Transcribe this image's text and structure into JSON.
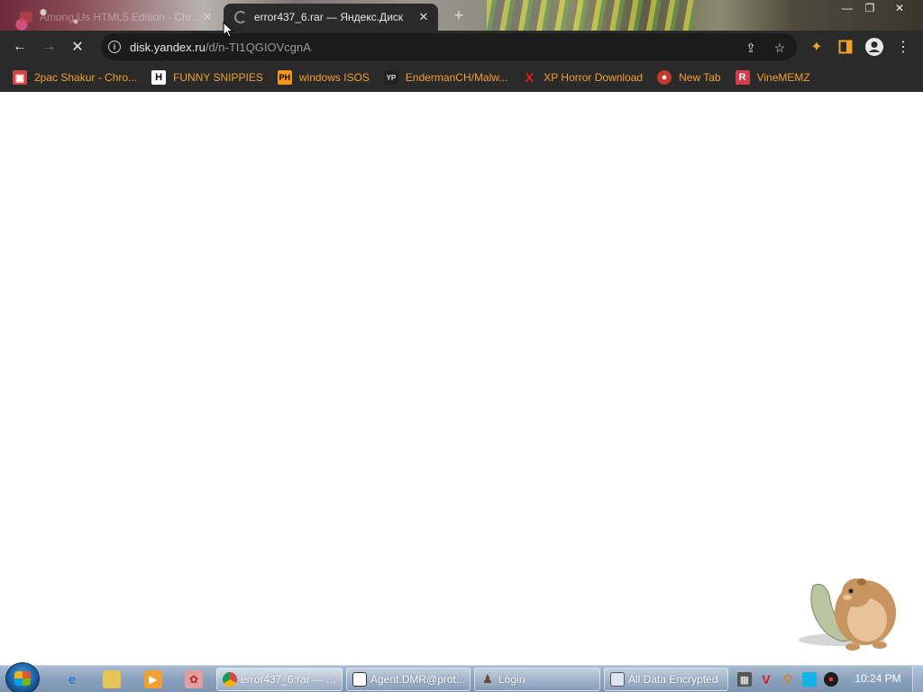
{
  "browser": {
    "tabs": [
      {
        "title": "Among Us HTML5 Edition - Chr...",
        "active": false
      },
      {
        "title": "error437_6.rar — Яндекс.Диск",
        "active": true
      }
    ],
    "address": {
      "domain": "disk.yandex.ru",
      "path": "/d/n-TI1QGIOVcgnA"
    },
    "bookmarks": [
      {
        "label": "2pac Shakur - Chro...",
        "icon": "bag-icon",
        "icon_text": "▣",
        "color": "#d24545"
      },
      {
        "label": "FUNNY SNIPPIES",
        "icon": "h-letter-icon",
        "icon_text": "H",
        "color": "#ffffff"
      },
      {
        "label": "windows ISOS",
        "icon": "ph-logo-icon",
        "icon_text": "PH",
        "color": "#f7971d"
      },
      {
        "label": "EndermanCH/Malw...",
        "icon": "yp-logo-icon",
        "icon_text": "YP",
        "color": "#222222"
      },
      {
        "label": "XP Horror Download",
        "icon": "x-red-icon",
        "icon_text": "X",
        "color": "#e02020"
      },
      {
        "label": "New Tab",
        "icon": "red-robot-icon",
        "icon_text": "●",
        "color": "#c0392b"
      },
      {
        "label": "VineMEMZ",
        "icon": "r-red-icon",
        "icon_text": "R",
        "color": "#d43c4c"
      }
    ]
  },
  "taskbar": {
    "buttons": [
      {
        "label": "error437_6.rar — ...",
        "icon": "chrome-icon",
        "active": true
      },
      {
        "label": "Agent.DMR@prot...",
        "icon": "window-app-icon",
        "active": false
      },
      {
        "label": "Login",
        "icon": "user-login-icon",
        "active": false
      },
      {
        "label": "All Data Encrypted",
        "icon": "dialog-icon",
        "active": false
      }
    ],
    "clock": "10:24 PM"
  },
  "colors": {
    "chrome_dark": "#2a2a2a",
    "bookmark_text": "#f0a030",
    "taskbar": "#8aa2bd"
  }
}
